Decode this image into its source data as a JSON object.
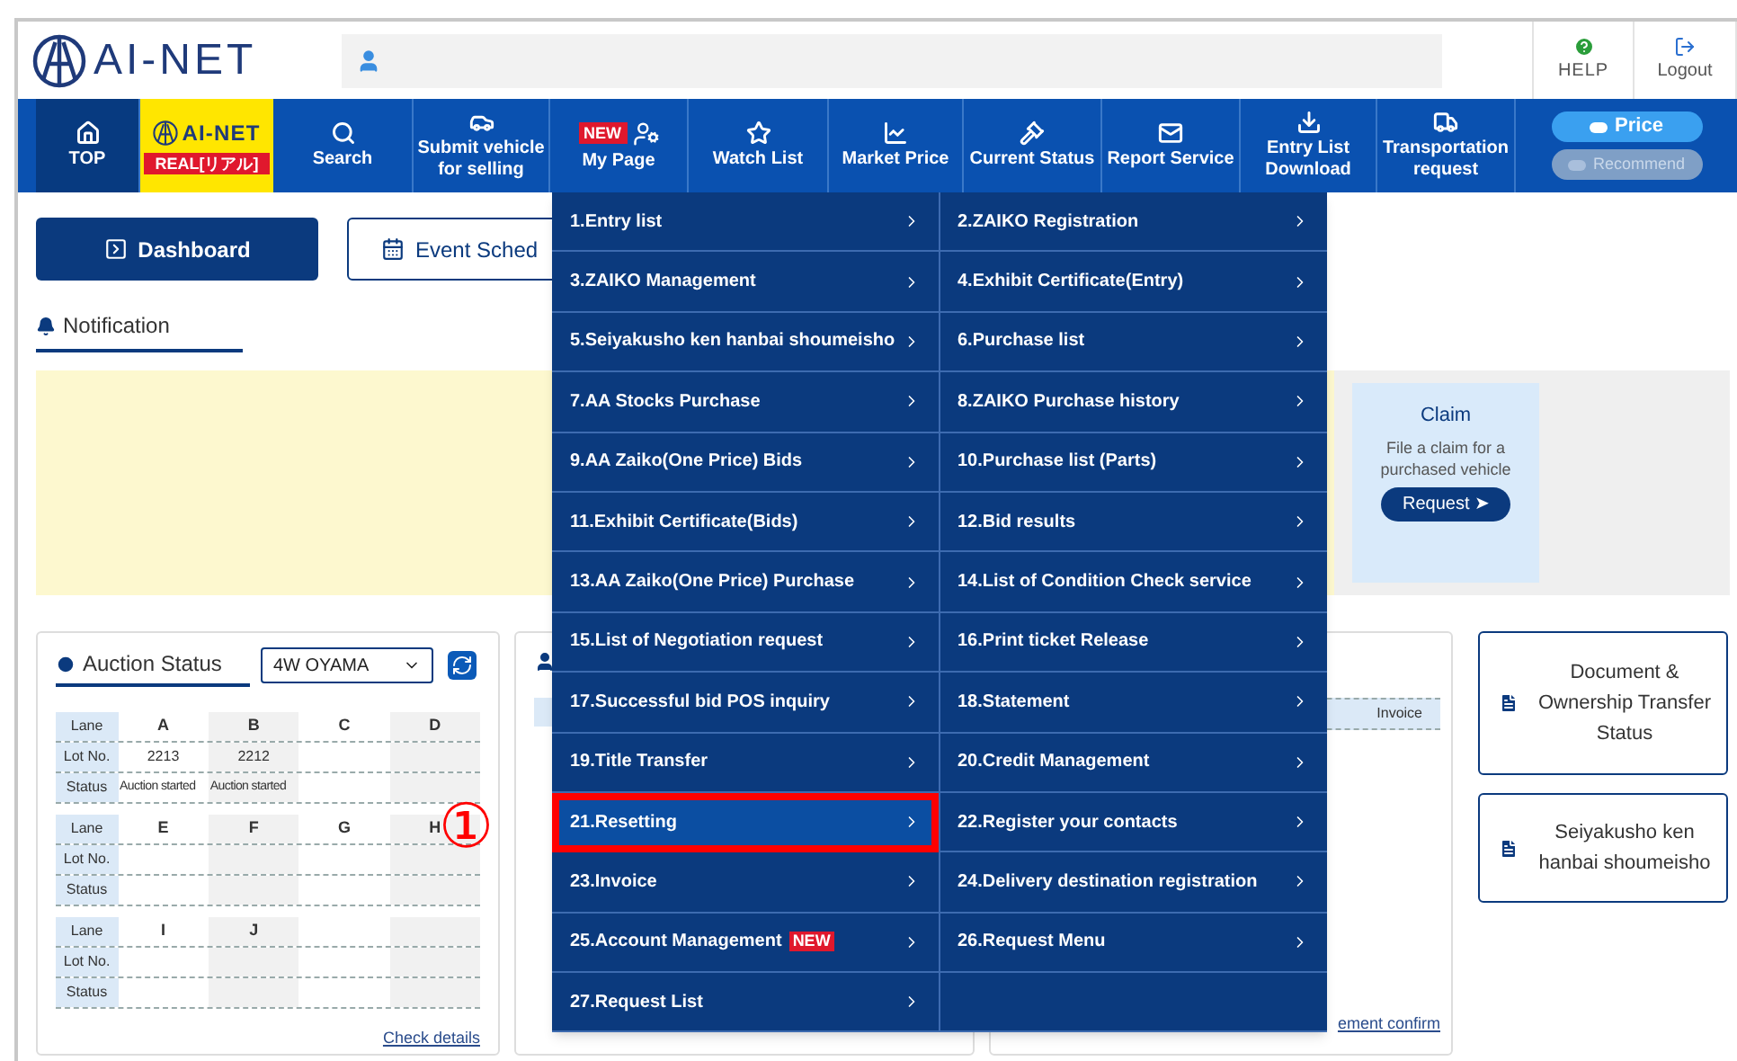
{
  "header": {
    "logo": "AI-NET",
    "help": "HELP",
    "logout": "Logout"
  },
  "nav": [
    {
      "kind": "icon",
      "label": "TOP",
      "selected": true
    },
    {
      "kind": "brand",
      "logo": "AI-NET",
      "label": "REAL[リアル]",
      "selected": false
    },
    {
      "kind": "icon",
      "label": "Search",
      "selected": false
    },
    {
      "kind": "icon",
      "label": "Submit vehicle for selling",
      "selected": false
    },
    {
      "kind": "badge",
      "badge": "NEW",
      "label": "My Page",
      "selected": false
    },
    {
      "kind": "icon",
      "label": "Watch List",
      "selected": false
    },
    {
      "kind": "icon",
      "label": "Market Price",
      "selected": false
    },
    {
      "kind": "icon",
      "label": "Current Status",
      "selected": false
    },
    {
      "kind": "icon",
      "label": "Report Service",
      "selected": false
    },
    {
      "kind": "icon",
      "label": "Entry List Download",
      "selected": false
    },
    {
      "kind": "icon",
      "label": "Transportation request",
      "selected": false
    }
  ],
  "view_toggles": [
    {
      "label": "Price",
      "on": true
    },
    {
      "label": "Recommend",
      "on": false
    }
  ],
  "tabs": [
    {
      "label": "Dashboard",
      "selected": true
    },
    {
      "label": "Event Sched",
      "selected": false
    }
  ],
  "notification": {
    "title": "Notification"
  },
  "claim": {
    "title": "Claim",
    "text": "File a claim for a purchased vehicle",
    "button": "Request ➤"
  },
  "auction_status": {
    "title": "Auction Status",
    "venue": "4W OYAMA",
    "link": "Check details",
    "groups": [
      {
        "labels": [
          "Lane",
          "Lot No.",
          "Status"
        ],
        "lanes": [
          {
            "lane": "A",
            "lot": "2213",
            "status": "Auction started"
          },
          {
            "lane": "B",
            "lot": "2212",
            "status": "Auction started"
          },
          {
            "lane": "C"
          },
          {
            "lane": "D"
          }
        ]
      },
      {
        "labels": [
          "Lane",
          "Lot No.",
          "Status"
        ],
        "lanes": [
          {
            "lane": "E"
          },
          {
            "lane": "F"
          },
          {
            "lane": "G"
          },
          {
            "lane": "H"
          }
        ]
      },
      {
        "labels": [
          "Lane",
          "Lot No.",
          "Status"
        ],
        "lanes": [
          {
            "lane": "I"
          },
          {
            "lane": "J"
          }
        ]
      }
    ]
  },
  "statement_panel": {
    "column": "Invoice",
    "link": "ement confirm"
  },
  "side_cards": [
    "Document & Ownership Transfer Status",
    "Seiyakusho ken hanbai shoumeisho"
  ],
  "my_page_menu": [
    {
      "label": "1.Entry list",
      "selected": false
    },
    {
      "label": "2.ZAIKO Registration",
      "selected": false
    },
    {
      "label": "3.ZAIKO Management",
      "selected": false
    },
    {
      "label": "4.Exhibit Certificate(Entry)",
      "selected": false
    },
    {
      "label": "5.Seiyakusho ken hanbai shoumeisho",
      "selected": false
    },
    {
      "label": "6.Purchase list",
      "selected": false
    },
    {
      "label": "7.AA Stocks Purchase",
      "selected": false
    },
    {
      "label": "8.ZAIKO Purchase history",
      "selected": false
    },
    {
      "label": "9.AA Zaiko(One Price) Bids",
      "selected": false
    },
    {
      "label": "10.Purchase list (Parts)",
      "selected": false
    },
    {
      "label": "11.Exhibit Certificate(Bids)",
      "selected": false
    },
    {
      "label": "12.Bid results",
      "selected": false
    },
    {
      "label": "13.AA Zaiko(One Price) Purchase",
      "selected": false
    },
    {
      "label": "14.List of Condition Check service",
      "selected": false
    },
    {
      "label": "15.List of Negotiation request",
      "selected": false
    },
    {
      "label": "16.Print ticket Release",
      "selected": false
    },
    {
      "label": "17.Successful bid POS inquiry",
      "selected": false
    },
    {
      "label": "18.Statement",
      "selected": false
    },
    {
      "label": "19.Title Transfer",
      "selected": false
    },
    {
      "label": "20.Credit Management",
      "selected": false
    },
    {
      "label": "21.Resetting",
      "selected": true
    },
    {
      "label": "22.Register your contacts",
      "selected": false
    },
    {
      "label": "23.Invoice",
      "selected": false
    },
    {
      "label": "24.Delivery destination registration",
      "selected": false
    },
    {
      "label": "25.Account Management",
      "badge": "NEW",
      "selected": false
    },
    {
      "label": "26.Request Menu",
      "selected": false
    },
    {
      "label": "27.Request List",
      "selected": false
    }
  ],
  "annotation": {
    "mark": "①"
  }
}
